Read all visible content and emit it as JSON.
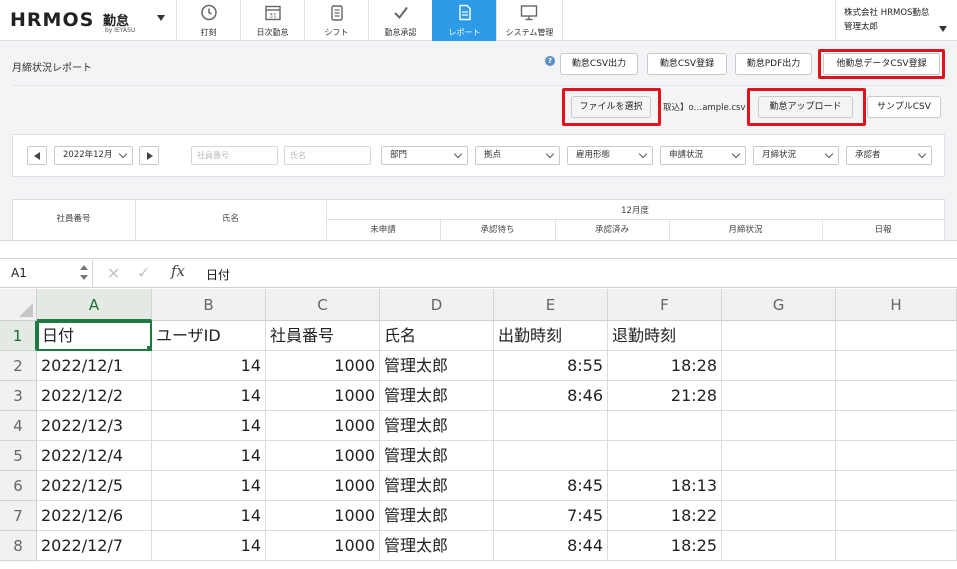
{
  "app": {
    "logo": {
      "brand": "HRMOS",
      "product": "勤怠",
      "by": "by IEYASU"
    },
    "nav": [
      {
        "label": "打刻",
        "icon": "clock-icon"
      },
      {
        "label": "日次勤怠",
        "icon": "calendar-icon"
      },
      {
        "label": "シフト",
        "icon": "shift-icon"
      },
      {
        "label": "勤怠承認",
        "icon": "checkmark-icon"
      },
      {
        "label": "レポート",
        "icon": "report-icon",
        "active": true
      },
      {
        "label": "システム管理",
        "icon": "monitor-icon"
      }
    ],
    "company": {
      "name": "株式会社 HRMOS勤怠",
      "user": "管理太郎"
    },
    "page_title": "月締状況レポート",
    "toolbar": {
      "help": "?",
      "csv_export": "勤怠CSV出力",
      "csv_register": "勤怠CSV登録",
      "pdf_export": "勤怠PDF出力",
      "other_csv_register": "他勤怠データCSV登録"
    },
    "upload": {
      "choose_file": "ファイルを選択",
      "selected_file": "取込】o…ample.csv",
      "upload_button": "勤怠アップロード",
      "sample_csv": "サンプルCSV"
    },
    "filters": {
      "month": "2022年12月",
      "employee_no_placeholder": "社員番号",
      "name_placeholder": "氏名",
      "department": "部門",
      "site": "拠点",
      "employment_type": "雇用形態",
      "application_status": "申請状況",
      "closing_status": "月締状況",
      "approver": "承認者"
    },
    "report_table": {
      "col_employee_no": "社員番号",
      "col_name": "氏名",
      "month_group": "12月度",
      "sub_headers": [
        "未申請",
        "承認待ち",
        "承認済み",
        "月締状況",
        "日報"
      ]
    },
    "highlight_color": "#e5101e",
    "accent_color": "#2e9be8"
  },
  "sheet": {
    "name_box": "A1",
    "formula_content": "日付",
    "columns": [
      "A",
      "B",
      "C",
      "D",
      "E",
      "F",
      "G",
      "H"
    ],
    "row_numbers": [
      "1",
      "2",
      "3",
      "4",
      "5",
      "6",
      "7",
      "8"
    ],
    "rows": [
      [
        "日付",
        "ユーザID",
        "社員番号",
        "氏名",
        "出勤時刻",
        "退勤時刻",
        "",
        ""
      ],
      [
        "2022/12/1",
        "14",
        "1000",
        "管理太郎",
        "8:55",
        "18:28",
        "",
        ""
      ],
      [
        "2022/12/2",
        "14",
        "1000",
        "管理太郎",
        "8:46",
        "21:28",
        "",
        ""
      ],
      [
        "2022/12/3",
        "14",
        "1000",
        "管理太郎",
        "",
        "",
        "",
        ""
      ],
      [
        "2022/12/4",
        "14",
        "1000",
        "管理太郎",
        "",
        "",
        "",
        ""
      ],
      [
        "2022/12/5",
        "14",
        "1000",
        "管理太郎",
        "8:45",
        "18:13",
        "",
        ""
      ],
      [
        "2022/12/6",
        "14",
        "1000",
        "管理太郎",
        "7:45",
        "18:22",
        "",
        ""
      ],
      [
        "2022/12/7",
        "14",
        "1000",
        "管理太郎",
        "8:44",
        "18:25",
        "",
        ""
      ]
    ],
    "selected_color": "#1e7a3e"
  }
}
